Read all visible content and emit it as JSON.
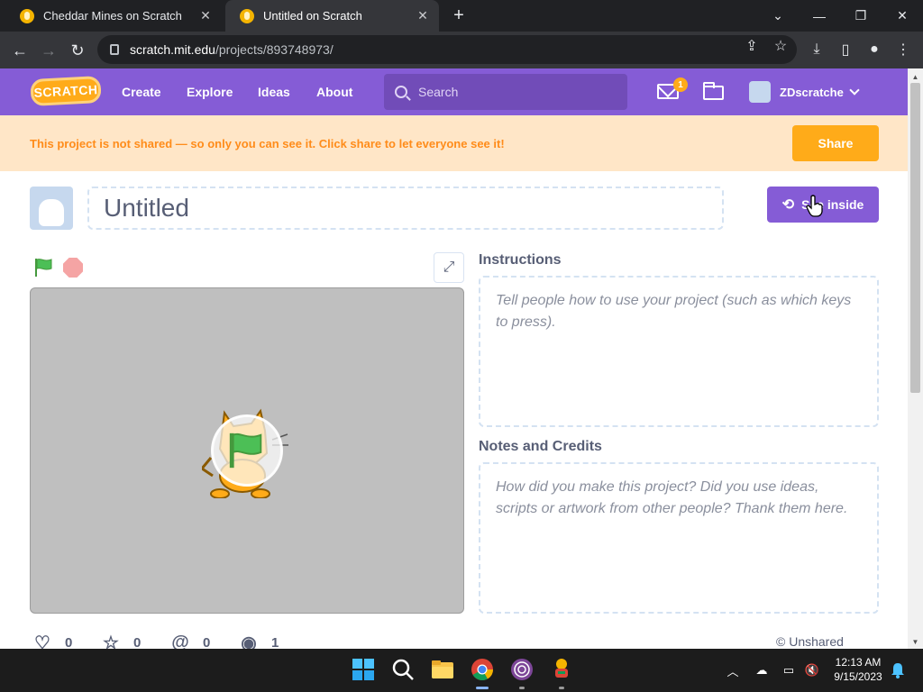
{
  "browser": {
    "tabs": [
      {
        "title": "Cheddar Mines on Scratch",
        "active": false
      },
      {
        "title": "Untitled on Scratch",
        "active": true
      }
    ],
    "url_host": "scratch.mit.edu",
    "url_path": "/projects/893748973/"
  },
  "nav": {
    "logo": "SCRATCH",
    "links": [
      "Create",
      "Explore",
      "Ideas",
      "About"
    ],
    "search_placeholder": "Search",
    "message_count": "1",
    "username": "ZDscratche"
  },
  "banner": {
    "text": "This project is not shared — so only you can see it. Click share to let everyone see it!",
    "share_label": "Share"
  },
  "project": {
    "title": "Untitled",
    "see_inside_label": "See inside"
  },
  "instructions": {
    "heading": "Instructions",
    "placeholder": "Tell people how to use your project (such as which keys to press)."
  },
  "notes": {
    "heading": "Notes and Credits",
    "placeholder": "How did you make this project? Did you use ideas, scripts or artwork from other people? Thank them here."
  },
  "stats": {
    "loves": "0",
    "favorites": "0",
    "remixes": "0",
    "views": "1",
    "share_status": "© Unshared"
  },
  "clock": {
    "time": "12:13 AM",
    "date": "9/15/2023"
  },
  "colors": {
    "scratch_purple": "#855cd6",
    "banner_bg": "#ffe6c7",
    "share_orange": "#ffab19",
    "stage_gray": "#bfbfbf"
  }
}
